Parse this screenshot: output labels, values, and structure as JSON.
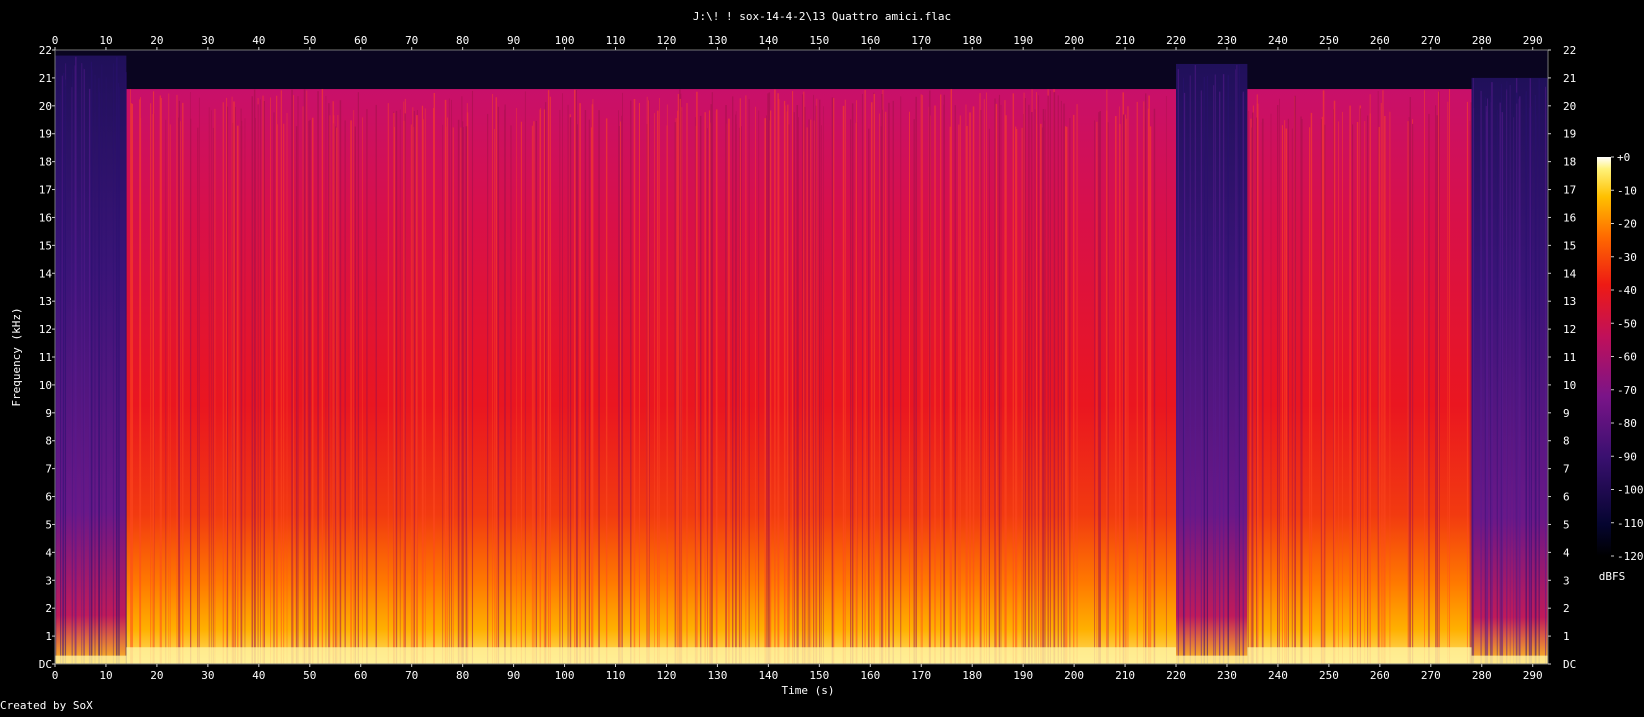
{
  "chart_data": {
    "type": "heatmap",
    "title": "J:\\! ! sox-14-4-2\\13 Quattro amici.flac",
    "xlabel": "Time (s)",
    "ylabel": "Frequency (kHz)",
    "xlim": [
      0,
      293
    ],
    "ylim": [
      0,
      22
    ],
    "x_ticks": [
      "0",
      "10",
      "20",
      "30",
      "40",
      "50",
      "60",
      "70",
      "80",
      "90",
      "100",
      "110",
      "120",
      "130",
      "140",
      "150",
      "160",
      "170",
      "180",
      "190",
      "200",
      "210",
      "220",
      "230",
      "240",
      "250",
      "260",
      "270",
      "280",
      "290"
    ],
    "y_ticks": [
      "DC",
      "1",
      "2",
      "3",
      "4",
      "5",
      "6",
      "7",
      "8",
      "9",
      "10",
      "11",
      "12",
      "13",
      "14",
      "15",
      "16",
      "17",
      "18",
      "19",
      "20",
      "21",
      "22"
    ],
    "colorbar": {
      "label": "dBFS",
      "ticks": [
        "+0",
        "-10",
        "-20",
        "-30",
        "-40",
        "-50",
        "-60",
        "-70",
        "-80",
        "-90",
        "-100",
        "-110",
        "-120"
      ],
      "range": [
        -120,
        0
      ]
    },
    "grid": false,
    "segments": [
      {
        "t_start": 0,
        "t_end": 14,
        "level_db": -88,
        "cutoff_khz": 21.8
      },
      {
        "t_start": 14,
        "t_end": 220,
        "level_db": -52,
        "cutoff_khz": 20.6
      },
      {
        "t_start": 220,
        "t_end": 234,
        "level_db": -85,
        "cutoff_khz": 21.5
      },
      {
        "t_start": 234,
        "t_end": 278,
        "level_db": -55,
        "cutoff_khz": 20.6
      },
      {
        "t_start": 278,
        "t_end": 293,
        "level_db": -85,
        "cutoff_khz": 21.0
      }
    ]
  },
  "footer": {
    "credit": "Created by SoX"
  }
}
